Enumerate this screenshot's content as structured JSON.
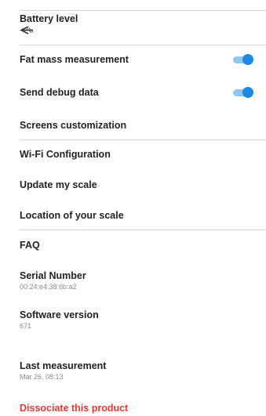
{
  "settings": {
    "battery": {
      "label": "Battery level",
      "icon": "battery-unknown-icon"
    },
    "fat_mass": {
      "label": "Fat mass measurement",
      "toggle_on": true
    },
    "debug": {
      "label": "Send debug data",
      "toggle_on": true
    },
    "screens": {
      "label": "Screens customization"
    },
    "wifi": {
      "label": "Wi-Fi Configuration"
    },
    "update": {
      "label": "Update my scale"
    },
    "location": {
      "label": "Location of your scale"
    },
    "faq": {
      "label": "FAQ"
    },
    "serial": {
      "label": "Serial Number",
      "value": "00:24:e4:38:6b:a2"
    },
    "software": {
      "label": "Software version",
      "value": "671"
    },
    "last_measurement": {
      "label": "Last measurement",
      "value": "Mar 26, 08:13"
    },
    "dissociate": {
      "label": "Dissociate this product"
    }
  },
  "colors": {
    "accent": "#1e88e5",
    "danger": "#e53935",
    "divider": "#d7d7d7"
  }
}
